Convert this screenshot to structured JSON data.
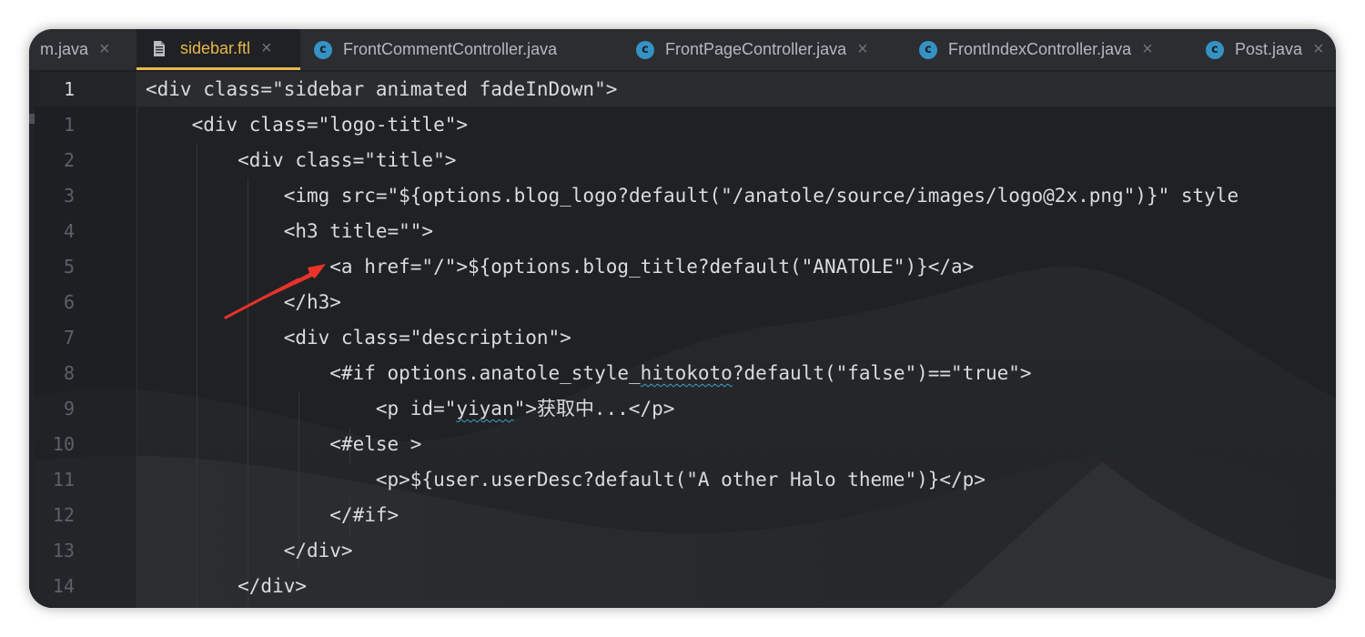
{
  "tabs": [
    {
      "label": "m.java",
      "icon": "java-class-icon",
      "active": false
    },
    {
      "label": "sidebar.ftl",
      "icon": "file-icon",
      "active": true
    },
    {
      "label": "FrontCommentController.java",
      "icon": "java-class-icon",
      "active": false
    },
    {
      "label": "FrontPageController.java",
      "icon": "java-class-icon",
      "active": false
    },
    {
      "label": "FrontIndexController.java",
      "icon": "java-class-icon",
      "active": false
    },
    {
      "label": "Post.java",
      "icon": "java-class-icon",
      "active": false
    }
  ],
  "tab_close_glyph": "×",
  "class_icon_glyph": "c",
  "line_numbers": [
    "1",
    "1",
    "2",
    "3",
    "4",
    "5",
    "6",
    "7",
    "8",
    "9",
    "10",
    "11",
    "12",
    "13",
    "14"
  ],
  "code": {
    "line_0": "<div class=\"sidebar animated fadeInDown\">",
    "line_1": "    <div class=\"logo-title\">",
    "line_2": "        <div class=\"title\">",
    "line_3": "            <img src=\"${options.blog_logo?default(\"/anatole/source/images/logo@2x.png\")}\" style",
    "line_4": "            <h3 title=\"\">",
    "line_5": "                <a href=\"/\">${options.blog_title?default(\"ANATOLE\")}</a>",
    "line_6": "            </h3>",
    "line_7": "            <div class=\"description\">",
    "line_8_a": "                <#if options.anatole_style_",
    "line_8_b": "hitokoto",
    "line_8_c": "?default(\"false\")==\"true\">",
    "line_9_a": "                    <p id=\"",
    "line_9_b": "yiyan",
    "line_9_c": "\">获取中...</p>",
    "line_10": "                <#else >",
    "line_11": "                    <p>${user.userDesc?default(\"A other Halo theme\")}</p>",
    "line_12": "                </#if>",
    "line_13": "            </div>",
    "line_14": "        </div>"
  },
  "colors": {
    "accent": "#e9b74a",
    "annotation_arrow": "#e8322a",
    "class_icon": "#3592c4"
  }
}
